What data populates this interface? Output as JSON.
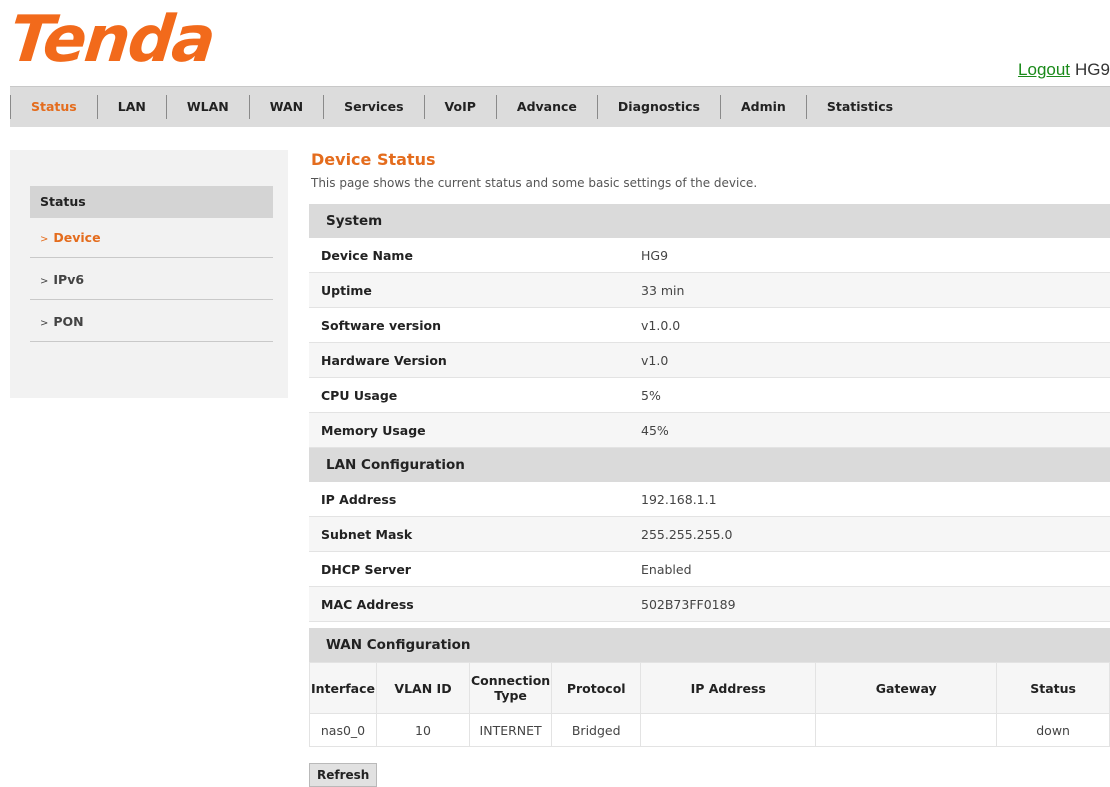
{
  "brand": {
    "logo_text": "Tenda",
    "logo_color": "#f26a1b"
  },
  "header": {
    "logout_label": "Logout",
    "device_label": "HG9"
  },
  "nav": {
    "items": [
      "Status",
      "LAN",
      "WLAN",
      "WAN",
      "Services",
      "VoIP",
      "Advance",
      "Diagnostics",
      "Admin",
      "Statistics"
    ],
    "active": "Status",
    "active_color": "#e46c1d"
  },
  "sidebar": {
    "header": "Status",
    "items": [
      {
        "label": "Device",
        "active": true
      },
      {
        "label": "IPv6",
        "active": false
      },
      {
        "label": "PON",
        "active": false
      }
    ],
    "arrow_glyph": ">"
  },
  "page": {
    "title": "Device Status",
    "description": "This page shows the current status and some basic settings of the device."
  },
  "system": {
    "title": "System",
    "rows": [
      {
        "label": "Device Name",
        "value": "HG9"
      },
      {
        "label": "Uptime",
        "value": "33 min"
      },
      {
        "label": "Software version",
        "value": "v1.0.0"
      },
      {
        "label": "Hardware Version",
        "value": "v1.0"
      },
      {
        "label": "CPU Usage",
        "value": "5%"
      },
      {
        "label": "Memory Usage",
        "value": "45%"
      }
    ]
  },
  "lan": {
    "title": "LAN Configuration",
    "rows": [
      {
        "label": "IP Address",
        "value": "192.168.1.1"
      },
      {
        "label": "Subnet Mask",
        "value": "255.255.255.0"
      },
      {
        "label": "DHCP Server",
        "value": "Enabled"
      },
      {
        "label": "MAC Address",
        "value": "502B73FF0189"
      }
    ]
  },
  "wan": {
    "title": "WAN Configuration",
    "columns": [
      "Interface",
      "VLAN ID",
      "Connection Type",
      "Protocol",
      "IP Address",
      "Gateway",
      "Status"
    ],
    "rows": [
      [
        "nas0_0",
        "10",
        "INTERNET",
        "Bridged",
        "",
        "",
        "down"
      ]
    ]
  },
  "buttons": {
    "refresh_label": "Refresh"
  }
}
